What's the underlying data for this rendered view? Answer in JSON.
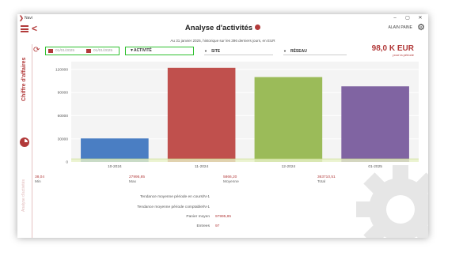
{
  "app": {
    "name": "Navi"
  },
  "window_controls": [
    "–",
    "▢",
    "✕"
  ],
  "header": {
    "title": "Analyse d'activités",
    "user": "ALAIN PAINE",
    "subtitle": "Au 31 janvier 2025, historique sur les 396 derniers jours, en EUR"
  },
  "sidebar": {
    "items": [
      {
        "label": "Chiffre d'affaires",
        "active": true
      },
      {
        "label": "Analyse d'activités",
        "active": false
      }
    ]
  },
  "filters": {
    "date_from_placeholder": "01/01/2025",
    "date_to_placeholder": "01/01/2025",
    "activity_label": "ACTIVITÉ",
    "site_label": "SITE",
    "network_label": "RÉSEAU"
  },
  "kpi": {
    "value": "98,0 K EUR",
    "sub": "pour la période"
  },
  "chart_data": {
    "type": "bar",
    "categories": [
      "10-2024",
      "11-2024",
      "12-2024",
      "01-2025"
    ],
    "values": [
      30500,
      122000,
      110000,
      98000
    ],
    "colors": [
      "#4a7ec3",
      "#c0504d",
      "#9bbb59",
      "#8064a2"
    ],
    "yticks": [
      0,
      30000,
      60000,
      90000,
      120000
    ],
    "ylim": [
      0,
      130000
    ],
    "grid": true,
    "reference_line": 4000
  },
  "stats": [
    {
      "value": "38,04",
      "label": "Min"
    },
    {
      "value": "27995,85",
      "label": "Max"
    },
    {
      "value": "5866,20",
      "label": "Moyenne"
    },
    {
      "value": "363710,51",
      "label": "Total"
    }
  ],
  "trends": [
    {
      "label": "Tendance moyenne période en cours/N-1",
      "value": ""
    },
    {
      "label": "Tendance moyenne période comptable/N-1",
      "value": ""
    },
    {
      "label": "Panier moyen",
      "value": "97995,85"
    },
    {
      "label": "Entrees",
      "value": "97"
    }
  ],
  "icons": [
    "hamburger-icon",
    "back-arrow-icon",
    "pie-chart-icon",
    "gear-icon",
    "refresh-icon",
    "calendar-icon",
    "caret-down-icon"
  ],
  "accent_color": "#b23a3a",
  "highlight_color": "#2fc02f"
}
